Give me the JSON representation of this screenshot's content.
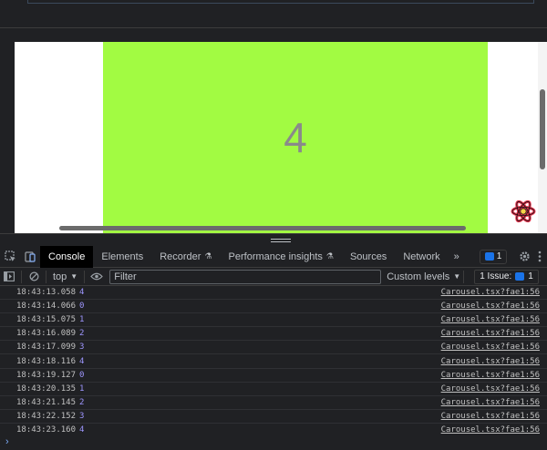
{
  "page": {
    "slide_number": "4",
    "slide_color": "#a2fb42"
  },
  "devtools": {
    "tabs": [
      {
        "label": "Console",
        "active": true
      },
      {
        "label": "Elements",
        "active": false
      },
      {
        "label": "Recorder",
        "active": false
      },
      {
        "label": "Performance insights",
        "active": false
      },
      {
        "label": "Sources",
        "active": false
      },
      {
        "label": "Network",
        "active": false
      }
    ],
    "more_tabs": "»",
    "messages_count": "1",
    "toolbar": {
      "context": "top",
      "filter_placeholder": "Filter",
      "levels": "Custom levels",
      "issues": "1 Issue:",
      "issues_count": "1"
    },
    "log": [
      {
        "time": "18:43:13.058",
        "value": "4",
        "source": "Carousel.tsx?fae1:56"
      },
      {
        "time": "18:43:14.066",
        "value": "0",
        "source": "Carousel.tsx?fae1:56"
      },
      {
        "time": "18:43:15.075",
        "value": "1",
        "source": "Carousel.tsx?fae1:56"
      },
      {
        "time": "18:43:16.089",
        "value": "2",
        "source": "Carousel.tsx?fae1:56"
      },
      {
        "time": "18:43:17.099",
        "value": "3",
        "source": "Carousel.tsx?fae1:56"
      },
      {
        "time": "18:43:18.116",
        "value": "4",
        "source": "Carousel.tsx?fae1:56"
      },
      {
        "time": "18:43:19.127",
        "value": "0",
        "source": "Carousel.tsx?fae1:56"
      },
      {
        "time": "18:43:20.135",
        "value": "1",
        "source": "Carousel.tsx?fae1:56"
      },
      {
        "time": "18:43:21.145",
        "value": "2",
        "source": "Carousel.tsx?fae1:56"
      },
      {
        "time": "18:43:22.152",
        "value": "3",
        "source": "Carousel.tsx?fae1:56"
      },
      {
        "time": "18:43:23.160",
        "value": "4",
        "source": "Carousel.tsx?fae1:56"
      }
    ],
    "prompt": "›"
  },
  "icons": [
    "inspect-icon",
    "device-toolbar-icon",
    "settings-icon",
    "kebab-menu-icon",
    "sidebar-toggle-icon",
    "clear-console-icon",
    "eye-icon",
    "react-devtools-icon",
    "flask-icon",
    "message-icon",
    "issue-icon"
  ]
}
